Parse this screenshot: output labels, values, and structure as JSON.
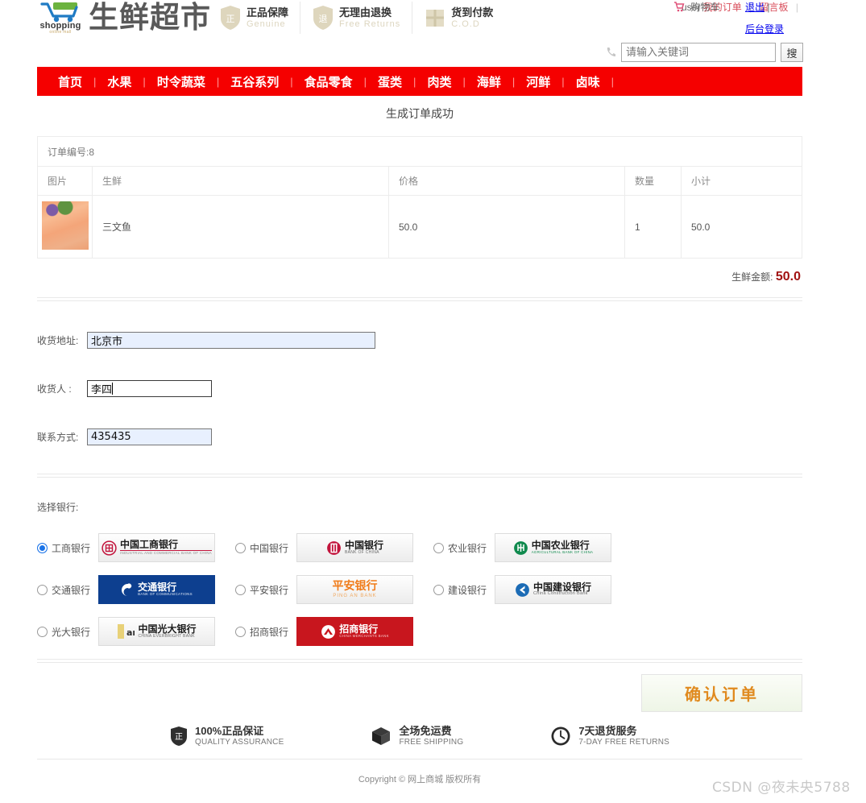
{
  "header": {
    "logo_text": "shopping",
    "logo_sub": "online mall",
    "brand": "生鲜超市",
    "badges": [
      {
        "icon": "shield-genuine-icon",
        "cn": "正品保障",
        "en": "Genuine"
      },
      {
        "icon": "shield-return-icon",
        "cn": "无理由退换",
        "en": "Free Returns"
      },
      {
        "icon": "box-cod-icon",
        "cn": "货到付款",
        "en": "C.O.D"
      }
    ],
    "user_label": "user",
    "my_orders": "我的订单",
    "message_board": "留言板",
    "cart": "购物车",
    "logout": "退出",
    "admin_login": "后台登录",
    "separator": "|"
  },
  "search": {
    "placeholder": "请输入关键词",
    "value": "",
    "button": "搜"
  },
  "nav": {
    "items": [
      "首页",
      "水果",
      "时令蔬菜",
      "五谷系列",
      "食品零食",
      "蛋类",
      "肉类",
      "海鲜",
      "河鲜",
      "卤味"
    ],
    "separator": "|",
    "bg_color": "#f50000"
  },
  "order": {
    "title": "生成订单成功",
    "order_no_label": "订单编号:8",
    "columns": [
      "图片",
      "生鲜",
      "价格",
      "数量",
      "小计"
    ],
    "rows": [
      {
        "image": "salmon-thumbnail",
        "name": "三文鱼",
        "price": "50.0",
        "qty": "1",
        "subtotal": "50.0"
      }
    ],
    "amount_label": "生鲜金额:",
    "amount_value": "50.0",
    "amount_color": "#a11212"
  },
  "form": {
    "address_label": "收货地址:",
    "address_value": "北京市",
    "receiver_label": "收货人  :",
    "receiver_value": "李四",
    "contact_label": "联系方式:",
    "contact_value": "435435"
  },
  "bank": {
    "label": "选择银行:",
    "selected": "工商银行",
    "options": [
      {
        "name": "工商银行",
        "logo_cn": "中国工商银行",
        "logo_en": "INDUSTRIAL AND COMMERCIAL BANK OF CHINA",
        "color": "#c2143c",
        "selected": true
      },
      {
        "name": "中国银行",
        "logo_cn": "中国银行",
        "logo_en": "BANK OF CHINA",
        "color": "#c2143c",
        "selected": false
      },
      {
        "name": "农业银行",
        "logo_cn": "中国农业银行",
        "logo_en": "AGRICULTURAL BANK OF CHINA",
        "color": "#108a4e",
        "selected": false
      },
      {
        "name": "交通银行",
        "logo_cn": "交通银行",
        "logo_en": "BANK OF COMMUNICATIONS",
        "color": "#ffffff",
        "selected": false
      },
      {
        "name": "平安银行",
        "logo_cn": "平安银行",
        "logo_en": "PING AN BANK",
        "color": "#f07c1a",
        "selected": false
      },
      {
        "name": "建设银行",
        "logo_cn": "中国建设银行",
        "logo_en": "China Construction Bank",
        "color": "#1b6bb5",
        "selected": false
      },
      {
        "name": "光大银行",
        "logo_cn": "中国光大银行",
        "logo_en": "CHINA EVERBRIGHT BANK",
        "color": "#8a1320",
        "selected": false
      },
      {
        "name": "招商银行",
        "logo_cn": "招商银行",
        "logo_en": "CHINA MERCHANTS BANK",
        "color": "#ffffff",
        "selected": false
      }
    ]
  },
  "confirm": {
    "label": "确认订单",
    "text_color": "#e08a1e"
  },
  "footer": {
    "badges": [
      {
        "icon": "shield-quality-icon",
        "cn": "100%正品保证",
        "en": "QUALITY ASSURANCE"
      },
      {
        "icon": "box-shipping-icon",
        "cn": "全场免运费",
        "en": "FREE SHIPPING"
      },
      {
        "icon": "clock-returns-icon",
        "cn": "7天退货服务",
        "en": "7-DAY FREE RETURNS"
      }
    ],
    "copyright": "Copyright © 网上商城 版权所有"
  },
  "watermark": "CSDN @夜未央5788"
}
